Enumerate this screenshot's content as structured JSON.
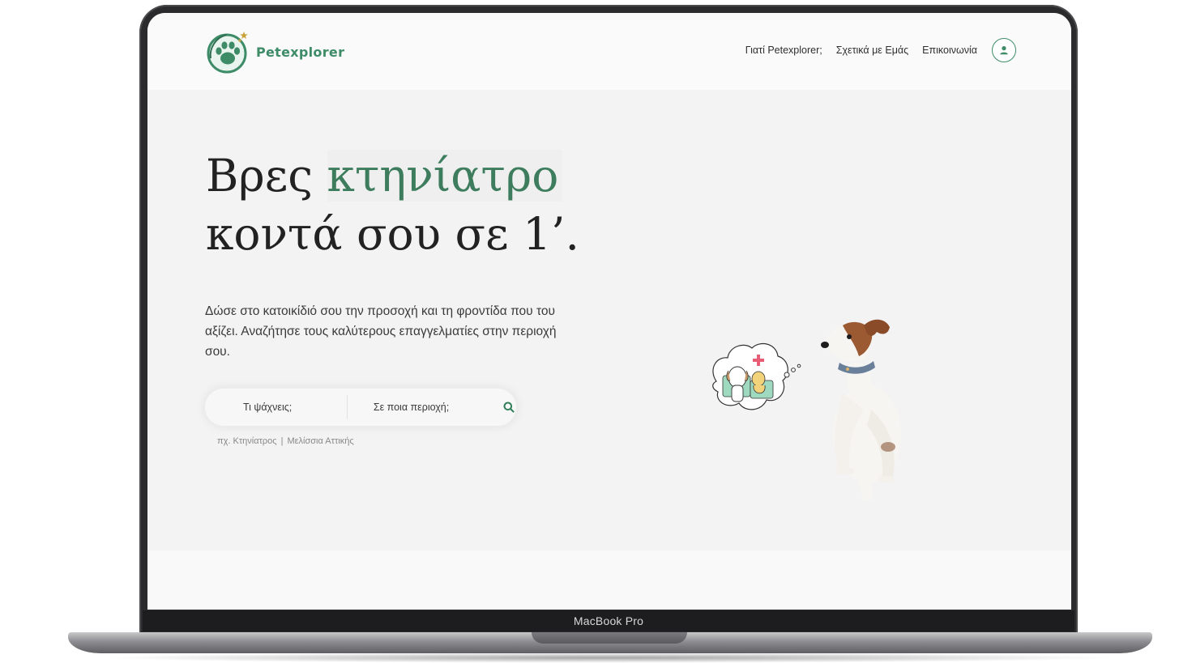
{
  "site": {
    "logo_text": "Petexplorer",
    "nav": [
      {
        "label": "Γιατί Petexplorer;"
      },
      {
        "label": "Σχετικά με Εμάς"
      },
      {
        "label": "Επικοινωνία"
      }
    ],
    "user_icon": "user-icon"
  },
  "hero": {
    "title_start": "Βρες ",
    "title_accent": "κτηνίατρο",
    "title_end": "κοντά σου σε 1’.",
    "subtitle": "Δώσε στο κατοικίδιό σου την προσοχή και τη φροντίδα που του αξίζει. Αναζήτησε τους καλύτερους επαγγελματίες στην περιοχή σου.",
    "search": {
      "what_placeholder": "Τι ψάχνεις;",
      "where_placeholder": "Σε ποια περιοχή;",
      "icon": "search-icon"
    },
    "hint_what": "πχ. Κτηνίατρος",
    "hint_sep": "|",
    "hint_where": "Μελίσσια Αττικής"
  },
  "device": {
    "label": "MacBook Pro"
  },
  "colors": {
    "accent": "#3d8b67",
    "title_accent": "#3d7d5e",
    "background": "#f3f3f3"
  }
}
